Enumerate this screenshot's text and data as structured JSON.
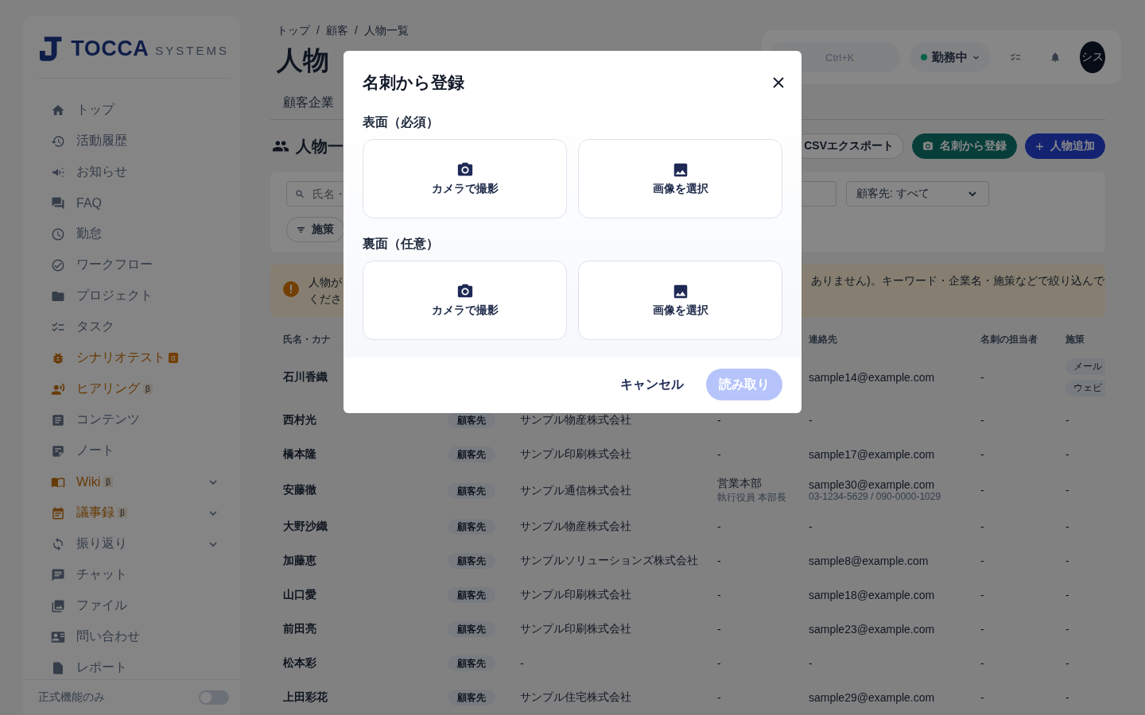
{
  "sidebar": {
    "logo": {
      "name": "TOCCA",
      "sub": "SYSTEMS"
    },
    "items": [
      {
        "label": "トップ",
        "accent": false,
        "expandable": false
      },
      {
        "label": "活動履歴",
        "accent": false,
        "expandable": false
      },
      {
        "label": "お知らせ",
        "accent": false,
        "expandable": false
      },
      {
        "label": "FAQ",
        "accent": false,
        "expandable": false
      },
      {
        "label": "勤怠",
        "accent": false,
        "expandable": false
      },
      {
        "label": "ワークフロー",
        "accent": false,
        "expandable": false
      },
      {
        "label": "プロジェクト",
        "accent": false,
        "expandable": false
      },
      {
        "label": "タスク",
        "accent": false,
        "expandable": false
      },
      {
        "label": "シナリオテスト",
        "accent": true,
        "expandable": false,
        "badge": {
          "text": "α",
          "kind": "alpha"
        }
      },
      {
        "label": "ヒアリング",
        "accent": true,
        "expandable": false,
        "badge": {
          "text": "β",
          "kind": "beta"
        }
      },
      {
        "label": "コンテンツ",
        "accent": false,
        "expandable": false
      },
      {
        "label": "ノート",
        "accent": false,
        "expandable": false
      },
      {
        "label": "Wiki",
        "accent": true,
        "expandable": true,
        "badge": {
          "text": "β",
          "kind": "beta"
        }
      },
      {
        "label": "議事録",
        "accent": true,
        "expandable": true,
        "badge": {
          "text": "β",
          "kind": "beta"
        }
      },
      {
        "label": "振り返り",
        "accent": false,
        "expandable": true
      },
      {
        "label": "チャット",
        "accent": false,
        "expandable": false
      },
      {
        "label": "ファイル",
        "accent": false,
        "expandable": false
      },
      {
        "label": "問い合わせ",
        "accent": false,
        "expandable": false
      },
      {
        "label": "レポート",
        "accent": false,
        "expandable": false
      }
    ],
    "footer": {
      "label": "正式機能のみ",
      "on": false
    }
  },
  "breadcrumb": {
    "items": [
      "トップ",
      "顧客",
      "人物一覧"
    ],
    "separator": "/"
  },
  "page_title": "人物",
  "header": {
    "search": {
      "shortcut": "Ctrl+K"
    },
    "status": {
      "label": "勤務中",
      "on": true
    },
    "avatar": "シス"
  },
  "tabs": [
    {
      "label": "顧客企業"
    }
  ],
  "section": {
    "title": "人物一",
    "buttons": [
      {
        "label": "CSVエクスポート",
        "kind": "outline"
      },
      {
        "label": "名刺から登録",
        "kind": "teal"
      },
      {
        "label": "人物追加",
        "kind": "primary"
      }
    ]
  },
  "filters": {
    "search_placeholder": "氏名・",
    "customer_select": "顧客先: すべて",
    "chip": "施策"
  },
  "alert": {
    "left_lines": [
      "人物が",
      "くださ"
    ],
    "right_text": "ありません)。キーワード・企業名・施策などで絞り込んで"
  },
  "table": {
    "columns": {
      "name": "氏名・カナ",
      "contact": "連絡先",
      "owner": "名刺の担当者",
      "tags": "施策"
    },
    "rows": [
      {
        "name": "石川香織",
        "email": "sample14@example.com",
        "owner": "-",
        "tags": [
          "メール",
          "ウェビ"
        ]
      },
      {
        "name": "西村光",
        "type": "顧客先",
        "company": "サンプル物産株式会社",
        "dept": "-",
        "email": "-",
        "owner": "-",
        "tags_text": "-"
      },
      {
        "name": "橋本隆",
        "type": "顧客先",
        "company": "サンプル印刷株式会社",
        "dept": "-",
        "email": "sample17@example.com",
        "owner": "-",
        "tags_text": "-"
      },
      {
        "name": "安藤徹",
        "type": "顧客先",
        "company": "サンプル通信株式会社",
        "dept": "営業本部",
        "position": "執行役員 本部長",
        "email": "sample30@example.com",
        "phone": "03-1234-5629 / 090-0000-1029",
        "owner": "-",
        "tags_text": "-"
      },
      {
        "name": "大野沙織",
        "type": "顧客先",
        "company": "サンプル物産株式会社",
        "dept": "-",
        "email": "-",
        "owner": "-",
        "tags_text": "-"
      },
      {
        "name": "加藤恵",
        "type": "顧客先",
        "company": "サンプルソリューションズ株式会社",
        "dept": "-",
        "email": "sample8@example.com",
        "owner": "-",
        "tags_text": "-"
      },
      {
        "name": "山口愛",
        "type": "顧客先",
        "company": "サンプル印刷株式会社",
        "dept": "-",
        "email": "sample18@example.com",
        "owner": "-",
        "tags_text": "-"
      },
      {
        "name": "前田亮",
        "type": "顧客先",
        "company": "サンプル印刷株式会社",
        "dept": "-",
        "email": "sample23@example.com",
        "owner": "-",
        "tags_text": "-"
      },
      {
        "name": "松本彩",
        "type": "顧客先",
        "company": "-",
        "dept": "-",
        "email": "-",
        "owner": "-",
        "tags_text": "-"
      },
      {
        "name": "上田彩花",
        "type": "顧客先",
        "company": "サンプル住宅株式会社",
        "dept": "-",
        "email": "sample29@example.com",
        "owner": "-",
        "tags_text": "-"
      }
    ]
  },
  "modal": {
    "title": "名刺から登録",
    "sections": [
      {
        "label": "表面（必須）",
        "options": [
          {
            "label": "カメラで撮影",
            "kind": "camera"
          },
          {
            "label": "画像を選択",
            "kind": "image"
          }
        ]
      },
      {
        "label": "裏面（任意）",
        "options": [
          {
            "label": "カメラで撮影",
            "kind": "camera"
          },
          {
            "label": "画像を選択",
            "kind": "image"
          }
        ]
      }
    ],
    "cancel": "キャンセル",
    "submit": {
      "label": "読み取り",
      "disabled": true
    }
  }
}
